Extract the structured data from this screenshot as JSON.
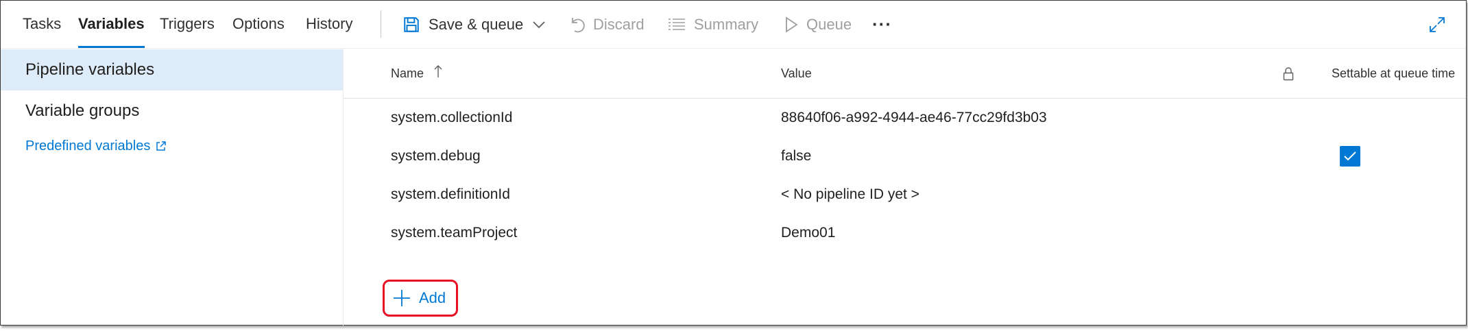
{
  "tabs": [
    {
      "label": "Tasks"
    },
    {
      "label": "Variables"
    },
    {
      "label": "Triggers"
    },
    {
      "label": "Options"
    },
    {
      "label": "History"
    }
  ],
  "toolbar": {
    "save_queue": "Save & queue",
    "discard": "Discard",
    "summary": "Summary",
    "queue": "Queue",
    "more": "···"
  },
  "nav": {
    "pipeline_variables": "Pipeline variables",
    "variable_groups": "Variable groups",
    "predefined_variables": "Predefined variables"
  },
  "table": {
    "headers": {
      "name": "Name",
      "value": "Value",
      "settable": "Settable at queue time"
    },
    "rows": [
      {
        "name": "system.collectionId",
        "value": "88640f06-a992-4944-ae46-77cc29fd3b03",
        "settable": false
      },
      {
        "name": "system.debug",
        "value": "false",
        "settable": true
      },
      {
        "name": "system.definitionId",
        "value": "< No pipeline ID yet >",
        "settable": false
      },
      {
        "name": "system.teamProject",
        "value": "Demo01",
        "settable": false
      }
    ]
  },
  "add_button": {
    "label": "Add"
  },
  "colors": {
    "accent": "#0078d4",
    "selected_nav": "#deecf9",
    "highlight_border": "#e81123",
    "disabled_text": "#a19f9d"
  },
  "icons": [
    "save-icon",
    "chevron-down-icon",
    "undo-icon",
    "list-icon",
    "play-icon",
    "more-icon",
    "expand-icon",
    "external-link-icon",
    "sort-up-arrow-icon",
    "lock-icon",
    "checkmark-icon",
    "plus-icon"
  ]
}
